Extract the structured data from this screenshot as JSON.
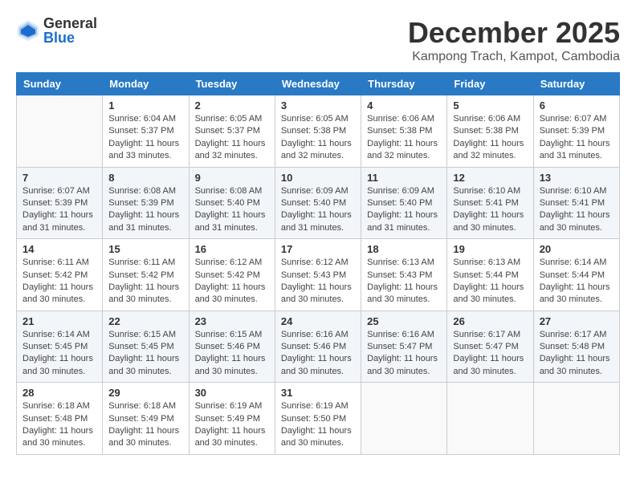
{
  "header": {
    "logo": {
      "general": "General",
      "blue": "Blue"
    },
    "title": "December 2025",
    "location": "Kampong Trach, Kampot, Cambodia"
  },
  "days_of_week": [
    "Sunday",
    "Monday",
    "Tuesday",
    "Wednesday",
    "Thursday",
    "Friday",
    "Saturday"
  ],
  "weeks": [
    [
      {
        "day": "",
        "info": ""
      },
      {
        "day": "1",
        "info": "Sunrise: 6:04 AM\nSunset: 5:37 PM\nDaylight: 11 hours\nand 33 minutes."
      },
      {
        "day": "2",
        "info": "Sunrise: 6:05 AM\nSunset: 5:37 PM\nDaylight: 11 hours\nand 32 minutes."
      },
      {
        "day": "3",
        "info": "Sunrise: 6:05 AM\nSunset: 5:38 PM\nDaylight: 11 hours\nand 32 minutes."
      },
      {
        "day": "4",
        "info": "Sunrise: 6:06 AM\nSunset: 5:38 PM\nDaylight: 11 hours\nand 32 minutes."
      },
      {
        "day": "5",
        "info": "Sunrise: 6:06 AM\nSunset: 5:38 PM\nDaylight: 11 hours\nand 32 minutes."
      },
      {
        "day": "6",
        "info": "Sunrise: 6:07 AM\nSunset: 5:39 PM\nDaylight: 11 hours\nand 31 minutes."
      }
    ],
    [
      {
        "day": "7",
        "info": "Sunrise: 6:07 AM\nSunset: 5:39 PM\nDaylight: 11 hours\nand 31 minutes."
      },
      {
        "day": "8",
        "info": "Sunrise: 6:08 AM\nSunset: 5:39 PM\nDaylight: 11 hours\nand 31 minutes."
      },
      {
        "day": "9",
        "info": "Sunrise: 6:08 AM\nSunset: 5:40 PM\nDaylight: 11 hours\nand 31 minutes."
      },
      {
        "day": "10",
        "info": "Sunrise: 6:09 AM\nSunset: 5:40 PM\nDaylight: 11 hours\nand 31 minutes."
      },
      {
        "day": "11",
        "info": "Sunrise: 6:09 AM\nSunset: 5:40 PM\nDaylight: 11 hours\nand 31 minutes."
      },
      {
        "day": "12",
        "info": "Sunrise: 6:10 AM\nSunset: 5:41 PM\nDaylight: 11 hours\nand 30 minutes."
      },
      {
        "day": "13",
        "info": "Sunrise: 6:10 AM\nSunset: 5:41 PM\nDaylight: 11 hours\nand 30 minutes."
      }
    ],
    [
      {
        "day": "14",
        "info": "Sunrise: 6:11 AM\nSunset: 5:42 PM\nDaylight: 11 hours\nand 30 minutes."
      },
      {
        "day": "15",
        "info": "Sunrise: 6:11 AM\nSunset: 5:42 PM\nDaylight: 11 hours\nand 30 minutes."
      },
      {
        "day": "16",
        "info": "Sunrise: 6:12 AM\nSunset: 5:42 PM\nDaylight: 11 hours\nand 30 minutes."
      },
      {
        "day": "17",
        "info": "Sunrise: 6:12 AM\nSunset: 5:43 PM\nDaylight: 11 hours\nand 30 minutes."
      },
      {
        "day": "18",
        "info": "Sunrise: 6:13 AM\nSunset: 5:43 PM\nDaylight: 11 hours\nand 30 minutes."
      },
      {
        "day": "19",
        "info": "Sunrise: 6:13 AM\nSunset: 5:44 PM\nDaylight: 11 hours\nand 30 minutes."
      },
      {
        "day": "20",
        "info": "Sunrise: 6:14 AM\nSunset: 5:44 PM\nDaylight: 11 hours\nand 30 minutes."
      }
    ],
    [
      {
        "day": "21",
        "info": "Sunrise: 6:14 AM\nSunset: 5:45 PM\nDaylight: 11 hours\nand 30 minutes."
      },
      {
        "day": "22",
        "info": "Sunrise: 6:15 AM\nSunset: 5:45 PM\nDaylight: 11 hours\nand 30 minutes."
      },
      {
        "day": "23",
        "info": "Sunrise: 6:15 AM\nSunset: 5:46 PM\nDaylight: 11 hours\nand 30 minutes."
      },
      {
        "day": "24",
        "info": "Sunrise: 6:16 AM\nSunset: 5:46 PM\nDaylight: 11 hours\nand 30 minutes."
      },
      {
        "day": "25",
        "info": "Sunrise: 6:16 AM\nSunset: 5:47 PM\nDaylight: 11 hours\nand 30 minutes."
      },
      {
        "day": "26",
        "info": "Sunrise: 6:17 AM\nSunset: 5:47 PM\nDaylight: 11 hours\nand 30 minutes."
      },
      {
        "day": "27",
        "info": "Sunrise: 6:17 AM\nSunset: 5:48 PM\nDaylight: 11 hours\nand 30 minutes."
      }
    ],
    [
      {
        "day": "28",
        "info": "Sunrise: 6:18 AM\nSunset: 5:48 PM\nDaylight: 11 hours\nand 30 minutes."
      },
      {
        "day": "29",
        "info": "Sunrise: 6:18 AM\nSunset: 5:49 PM\nDaylight: 11 hours\nand 30 minutes."
      },
      {
        "day": "30",
        "info": "Sunrise: 6:19 AM\nSunset: 5:49 PM\nDaylight: 11 hours\nand 30 minutes."
      },
      {
        "day": "31",
        "info": "Sunrise: 6:19 AM\nSunset: 5:50 PM\nDaylight: 11 hours\nand 30 minutes."
      },
      {
        "day": "",
        "info": ""
      },
      {
        "day": "",
        "info": ""
      },
      {
        "day": "",
        "info": ""
      }
    ]
  ]
}
